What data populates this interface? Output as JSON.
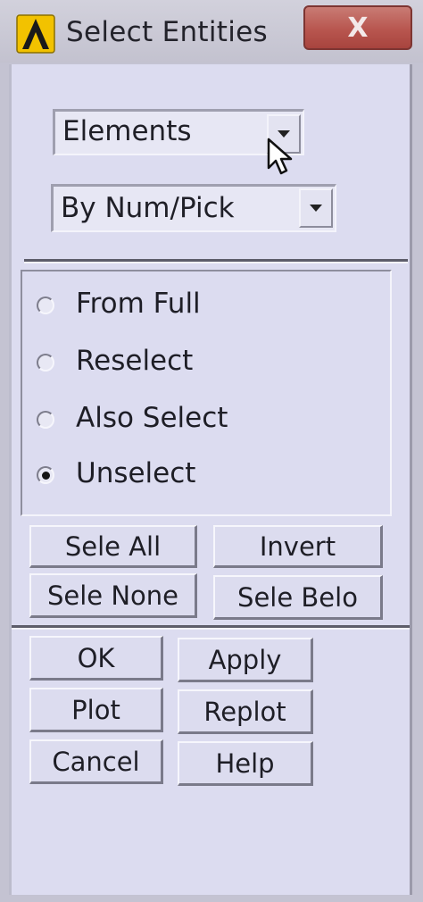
{
  "window": {
    "title": "Select Entities",
    "close_glyph": "X",
    "app_icon": "ansys-logo-icon"
  },
  "entity_dropdown": {
    "value": "Elements",
    "arrow_icon": "dropdown-arrow-icon"
  },
  "method_dropdown": {
    "value": "By Num/Pick",
    "arrow_icon": "dropdown-arrow-icon"
  },
  "mode_options": [
    {
      "label": "From Full",
      "selected": false
    },
    {
      "label": "Reselect",
      "selected": false
    },
    {
      "label": "Also Select",
      "selected": false
    },
    {
      "label": "Unselect",
      "selected": true
    }
  ],
  "selection_buttons": {
    "sele_all": "Sele All",
    "invert": "Invert",
    "sele_none": "Sele None",
    "sele_belo": "Sele Belo"
  },
  "action_buttons": {
    "ok": "OK",
    "apply": "Apply",
    "plot": "Plot",
    "replot": "Replot",
    "cancel": "Cancel",
    "help": "Help"
  },
  "colors": {
    "close_button": "#b8564f",
    "panel": "#dcdcf0",
    "icon_yellow": "#f2c200"
  }
}
